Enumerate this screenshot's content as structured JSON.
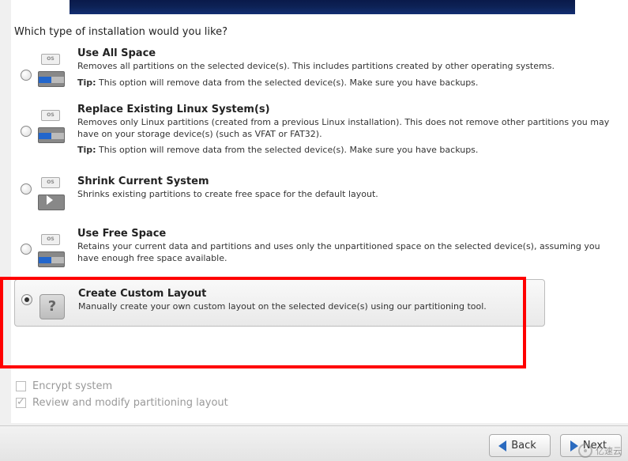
{
  "question": "Which type of installation would you like?",
  "options": {
    "use_all": {
      "title": "Use All Space",
      "desc": "Removes all partitions on the selected device(s).  This includes partitions created by other operating systems.",
      "tip_label": "Tip:",
      "tip": " This option will remove data from the selected device(s).  Make sure you have backups."
    },
    "replace": {
      "title": "Replace Existing Linux System(s)",
      "desc": "Removes only Linux partitions (created from a previous Linux installation).  This does not remove other partitions you may have on your storage device(s) (such as VFAT or FAT32).",
      "tip_label": "Tip:",
      "tip": " This option will remove data from the selected device(s).  Make sure you have backups."
    },
    "shrink": {
      "title": "Shrink Current System",
      "desc": "Shrinks existing partitions to create free space for the default layout."
    },
    "free": {
      "title": "Use Free Space",
      "desc": "Retains your current data and partitions and uses only the unpartitioned space on the selected device(s), assuming you have enough free space available."
    },
    "custom": {
      "title": "Create Custom Layout",
      "desc": "Manually create your own custom layout on the selected device(s) using our partitioning tool."
    }
  },
  "selected_option": "custom",
  "checkboxes": {
    "encrypt": {
      "label": "Encrypt system",
      "checked": false,
      "enabled": false
    },
    "review": {
      "label": "Review and modify partitioning layout",
      "checked": true,
      "enabled": false
    }
  },
  "buttons": {
    "back": "Back",
    "next": "Next"
  },
  "icons": {
    "os_label": "OS",
    "question_mark": "?"
  },
  "watermark": "亿速云"
}
